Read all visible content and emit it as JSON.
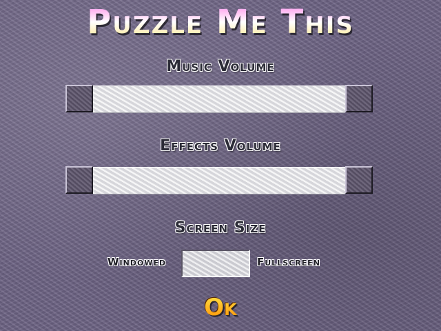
{
  "title": "Puzzle Me This",
  "music": {
    "heading": "Music Volume"
  },
  "effects": {
    "heading": "Effects Volume"
  },
  "screen": {
    "heading": "Screen Size",
    "windowed_label": "Windowed",
    "fullscreen_label": "Fullscreen"
  },
  "ok_label": "Ok",
  "colors": {
    "background": "#6e6485",
    "title_gradient_top": "#ff7ee6",
    "title_gradient_bottom": "#ffe37a",
    "ok_gradient_top": "#ffe84a",
    "ok_gradient_bottom": "#ff8a00",
    "track": "#e8e8ea",
    "knob": "#5d556c"
  }
}
